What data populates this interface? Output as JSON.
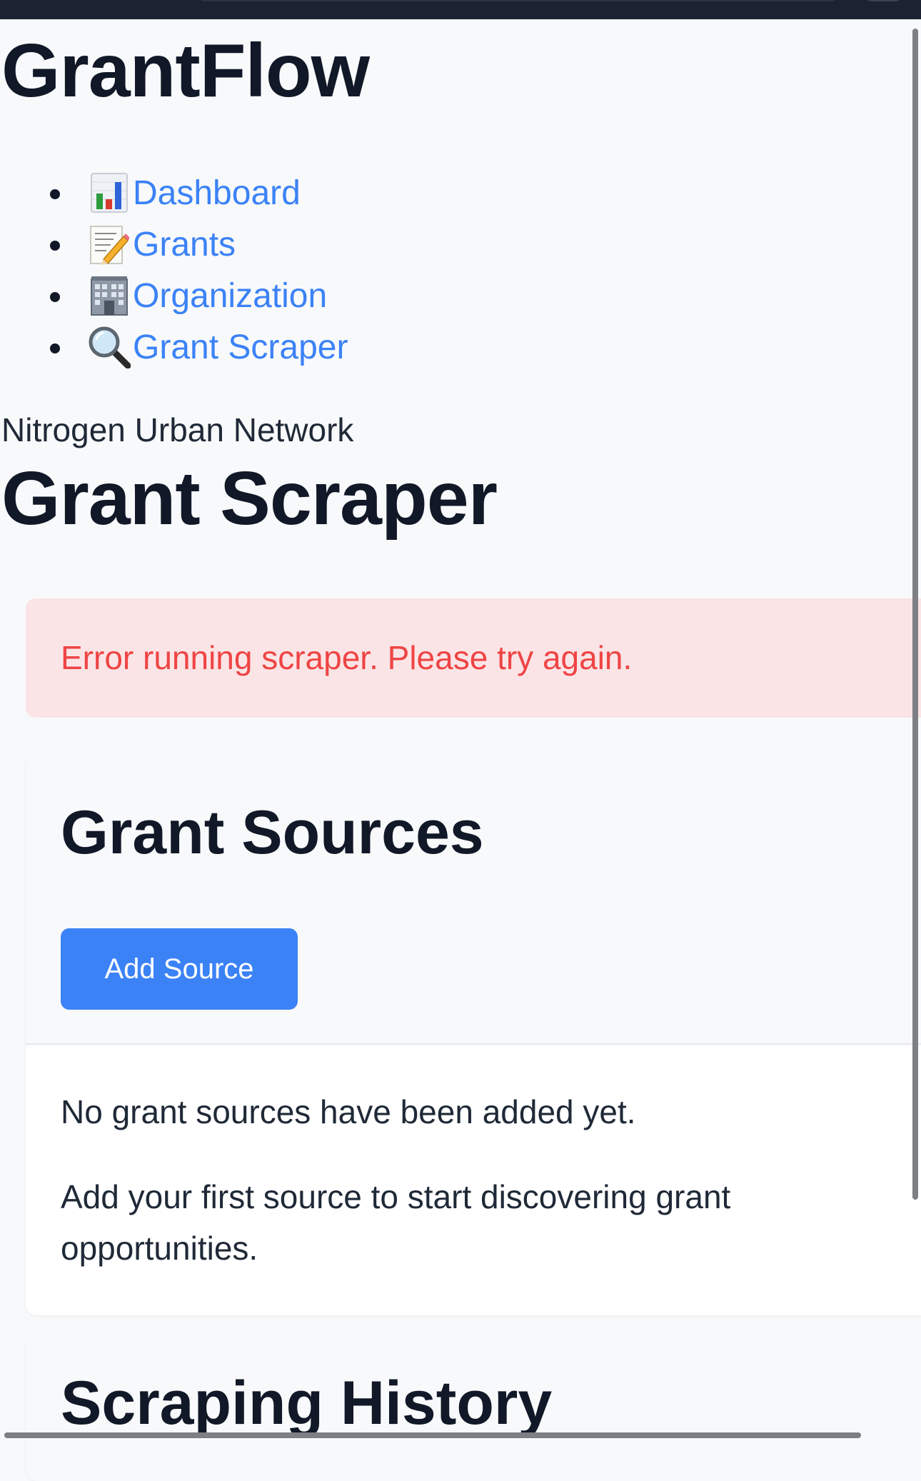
{
  "app": {
    "brand": "GrantFlow"
  },
  "nav": {
    "items": [
      {
        "icon": "bar-chart-icon",
        "label": "Dashboard"
      },
      {
        "icon": "memo-icon",
        "label": "Grants"
      },
      {
        "icon": "office-building-icon",
        "label": "Organization"
      },
      {
        "icon": "magnifier-icon",
        "label": "Grant Scraper"
      }
    ]
  },
  "header": {
    "organization": "Nitrogen Urban Network",
    "title": "Grant Scraper"
  },
  "alert": {
    "message": "Error running scraper. Please try again."
  },
  "sources": {
    "title": "Grant Sources",
    "add_button": "Add Source",
    "empty_line1": "No grant sources have been added yet.",
    "empty_line2": "Add your first source to start discovering grant opportunities."
  },
  "history": {
    "title": "Scraping History"
  },
  "colors": {
    "accent": "#3b82f6",
    "error_text": "#ef4444",
    "error_bg": "#fbe4e6",
    "topbar": "#1b2231"
  }
}
